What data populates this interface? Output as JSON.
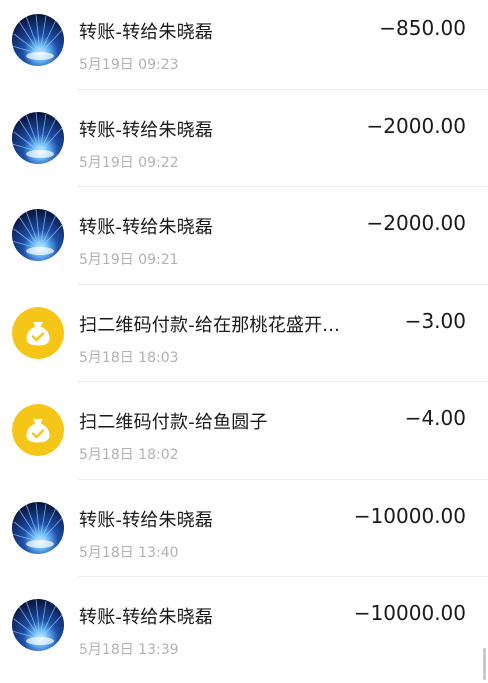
{
  "transactions": [
    {
      "icon": "user-avatar-icon",
      "title": "转账-转给朱晓磊",
      "time": "5月19日 09:23",
      "amount": "−850.00"
    },
    {
      "icon": "user-avatar-icon",
      "title": "转账-转给朱晓磊",
      "time": "5月19日 09:22",
      "amount": "−2000.00"
    },
    {
      "icon": "user-avatar-icon",
      "title": "转账-转给朱晓磊",
      "time": "5月19日 09:21",
      "amount": "−2000.00"
    },
    {
      "icon": "money-bag-icon",
      "title": "扫二维码付款-给在那桃花盛开...",
      "time": "5月18日 18:03",
      "amount": "−3.00"
    },
    {
      "icon": "money-bag-icon",
      "title": "扫二维码付款-给鱼圆子",
      "time": "5月18日 18:02",
      "amount": "−4.00"
    },
    {
      "icon": "user-avatar-icon",
      "title": "转账-转给朱晓磊",
      "time": "5月18日 13:40",
      "amount": "−10000.00"
    },
    {
      "icon": "user-avatar-icon",
      "title": "转账-转给朱晓磊",
      "time": "5月18日 13:39",
      "amount": "−10000.00"
    }
  ],
  "colors": {
    "money_bag": "#f5c518",
    "avatar_dark": "#0a1a4a",
    "avatar_light": "#4fa3ff",
    "amount_text": "#1a1a1a",
    "time_text": "#b2b2b2"
  }
}
